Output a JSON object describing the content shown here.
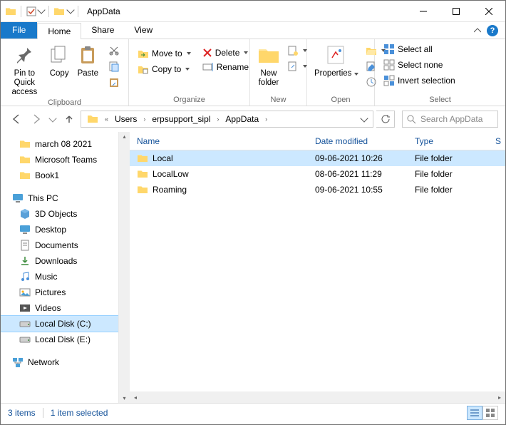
{
  "title": "AppData",
  "tabs": {
    "file": "File",
    "home": "Home",
    "share": "Share",
    "view": "View"
  },
  "ribbon": {
    "clipboard": {
      "label": "Clipboard",
      "pin": "Pin to Quick\naccess",
      "copy": "Copy",
      "paste": "Paste"
    },
    "organize": {
      "label": "Organize",
      "moveto": "Move to",
      "copyto": "Copy to",
      "delete": "Delete",
      "rename": "Rename"
    },
    "new": {
      "label": "New",
      "newfolder": "New\nfolder"
    },
    "open": {
      "label": "Open",
      "properties": "Properties"
    },
    "select": {
      "label": "Select",
      "all": "Select all",
      "none": "Select none",
      "invert": "Invert selection"
    }
  },
  "breadcrumb": [
    "Users",
    "erpsupport_sipl",
    "AppData"
  ],
  "search_placeholder": "Search AppData",
  "columns": {
    "name": "Name",
    "date": "Date modified",
    "type": "Type",
    "s": "S"
  },
  "rows": [
    {
      "name": "Local",
      "date": "09-06-2021 10:26",
      "type": "File folder",
      "selected": true
    },
    {
      "name": "LocalLow",
      "date": "08-06-2021 11:29",
      "type": "File folder",
      "selected": false
    },
    {
      "name": "Roaming",
      "date": "09-06-2021 10:55",
      "type": "File folder",
      "selected": false
    }
  ],
  "sidebar": {
    "quick": [
      "march 08 2021",
      "Microsoft Teams",
      "Book1"
    ],
    "thispc": "This PC",
    "pcitems": [
      "3D Objects",
      "Desktop",
      "Documents",
      "Downloads",
      "Music",
      "Pictures",
      "Videos",
      "Local Disk (C:)",
      "Local Disk (E:)"
    ],
    "network": "Network",
    "selected": "Local Disk (C:)"
  },
  "status": {
    "count": "3 items",
    "sel": "1 item selected"
  }
}
